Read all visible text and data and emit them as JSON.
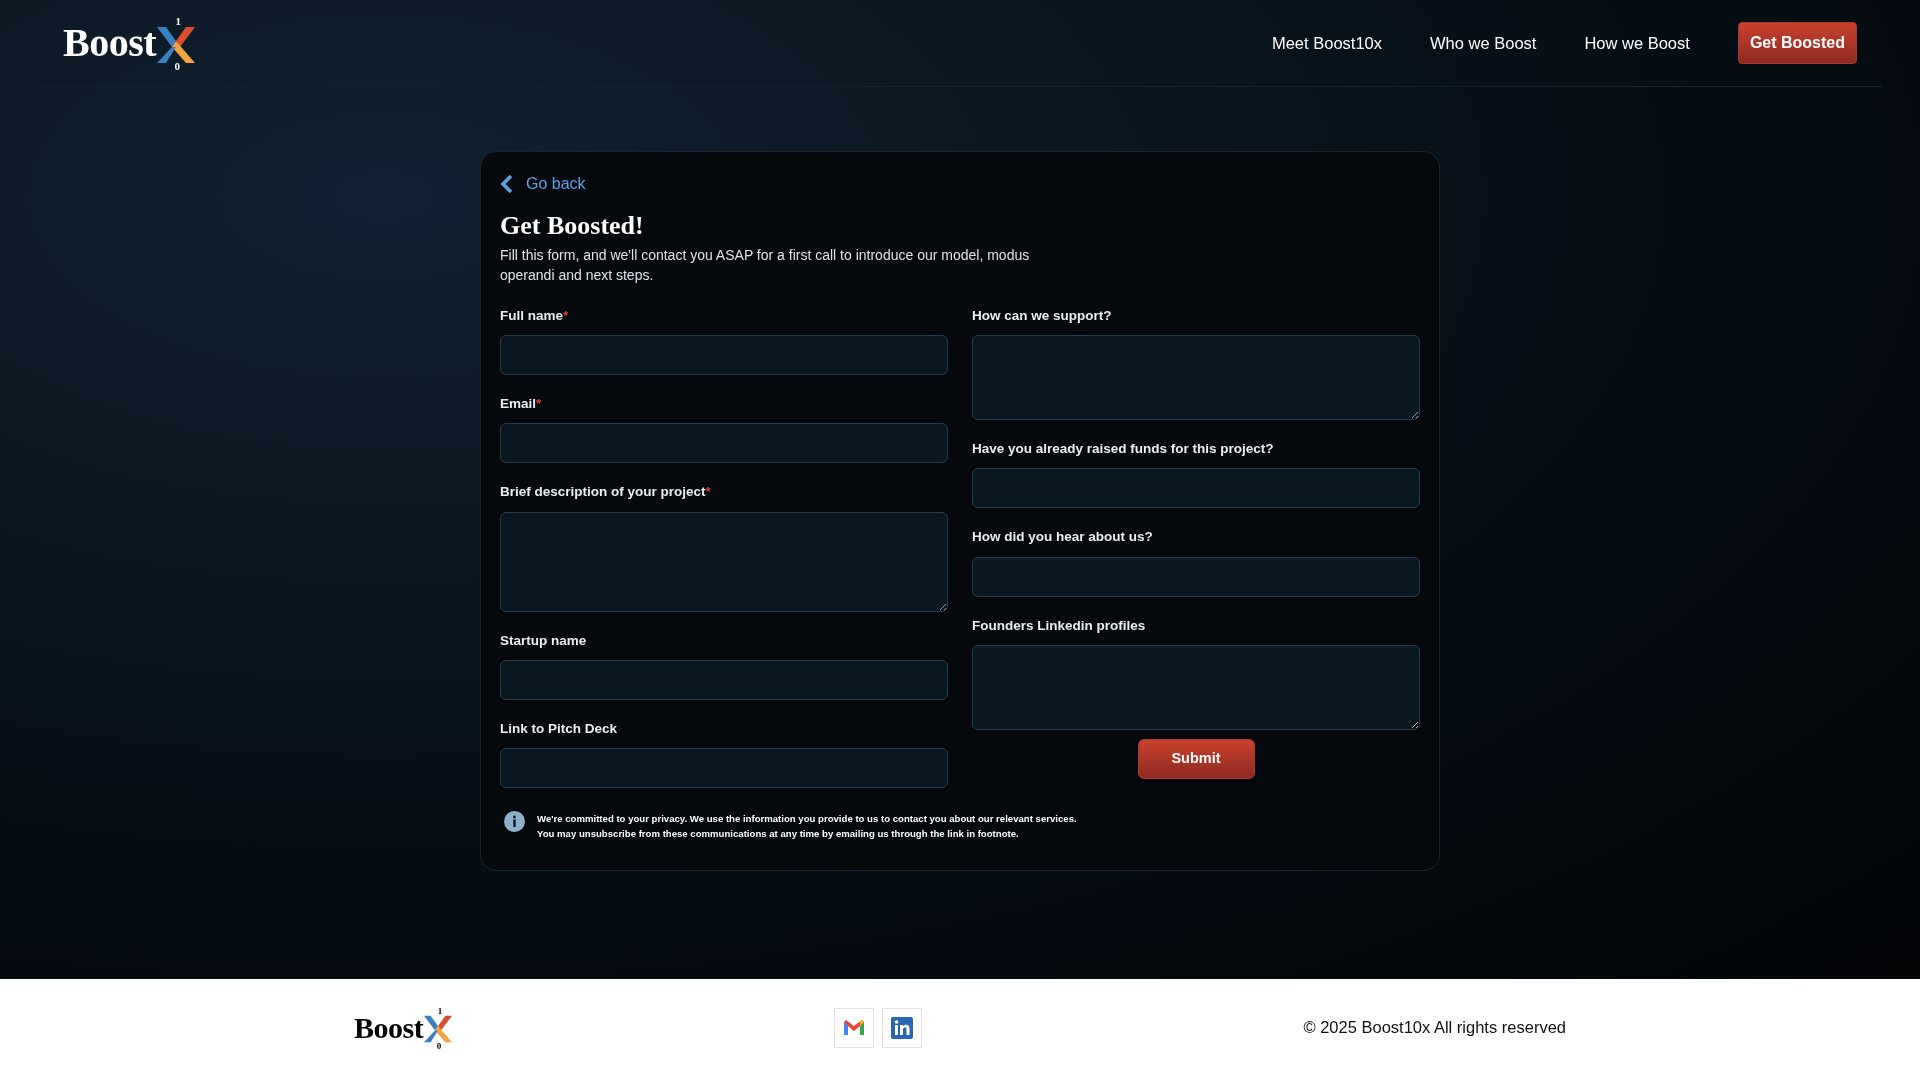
{
  "header": {
    "logo": {
      "word": "Boost",
      "top_digit": "1",
      "bottom_digit": "0"
    },
    "nav_links": [
      "Meet Boost10x",
      "Who we Boost",
      "How we Boost"
    ],
    "cta": "Get Boosted"
  },
  "form_card": {
    "back_link": "Go back",
    "title": "Get Boosted!",
    "intro": "Fill this form, and we'll contact you ASAP for a first call to introduce our model, modus operandi and next steps.",
    "left_fields": [
      {
        "label": "Full name",
        "required_mark": "*",
        "kind": "input"
      },
      {
        "label": "Email",
        "required_mark": "*",
        "kind": "input"
      },
      {
        "label": "Brief description of your project",
        "required_mark": "*",
        "kind": "textarea"
      },
      {
        "label": "Startup name",
        "kind": "input"
      },
      {
        "label": "Link to Pitch Deck",
        "kind": "input"
      }
    ],
    "right_fields": [
      {
        "label": "How can we support?",
        "kind": "textarea"
      },
      {
        "label": "Have you already raised funds for this project?",
        "kind": "input"
      },
      {
        "label": "How did you hear about us?",
        "kind": "input"
      },
      {
        "label": "Founders Linkedin profiles",
        "kind": "textarea"
      }
    ],
    "submit": "Submit",
    "privacy_lines": [
      "We're committed to your privacy. We use the information you provide to us to contact you about our relevant services.",
      "You may unsubscribe from these communications at any time by emailing us through the link in footnote."
    ]
  },
  "footer": {
    "logo": {
      "word": "Boost",
      "top_digit": "1",
      "bottom_digit": "0"
    },
    "copyright": "© 2025 Boost10x All rights reserved"
  }
}
